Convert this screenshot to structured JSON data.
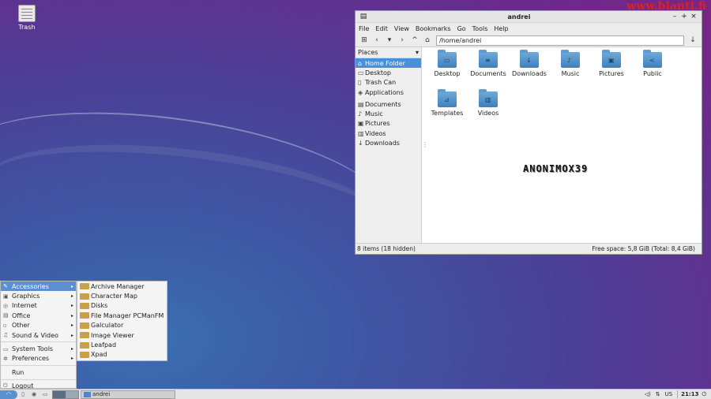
{
  "desktop": {
    "watermark": "www.blanti.fi",
    "icons": [
      {
        "label": "Trash",
        "icon": "trash-icon"
      }
    ]
  },
  "window": {
    "title": "andrei",
    "menu": [
      "File",
      "Edit",
      "View",
      "Bookmarks",
      "Go",
      "Tools",
      "Help"
    ],
    "address": "/home/andrei",
    "places_label": "Places",
    "sidebar": [
      {
        "label": "Home Folder",
        "icon": "home-icon",
        "selected": true
      },
      {
        "label": "Desktop",
        "icon": "desktop-icon"
      },
      {
        "label": "Trash Can",
        "icon": "trash-icon"
      },
      {
        "label": "Applications",
        "icon": "applications-icon"
      },
      {
        "label": "Documents",
        "icon": "documents-icon"
      },
      {
        "label": "Music",
        "icon": "music-icon"
      },
      {
        "label": "Pictures",
        "icon": "pictures-icon"
      },
      {
        "label": "Videos",
        "icon": "videos-icon"
      },
      {
        "label": "Downloads",
        "icon": "downloads-icon"
      }
    ],
    "folders": [
      {
        "label": "Desktop",
        "glyph": "▭"
      },
      {
        "label": "Documents",
        "glyph": "≡"
      },
      {
        "label": "Downloads",
        "glyph": "↓"
      },
      {
        "label": "Music",
        "glyph": "♪"
      },
      {
        "label": "Pictures",
        "glyph": "▣"
      },
      {
        "label": "Public",
        "glyph": "<"
      },
      {
        "label": "Templates",
        "glyph": "⊿"
      },
      {
        "label": "Videos",
        "glyph": "▥"
      }
    ],
    "status_left": "8 items (18 hidden)",
    "status_right": "Free space: 5,8 GiB (Total: 8,4 GiB)",
    "overlay_text": "ANONIMOX39"
  },
  "start_menu": {
    "items": [
      {
        "label": "Accessories",
        "icon": "accessories-icon",
        "submenu": true,
        "selected": true
      },
      {
        "label": "Graphics",
        "icon": "graphics-icon",
        "submenu": true
      },
      {
        "label": "Internet",
        "icon": "internet-icon",
        "submenu": true
      },
      {
        "label": "Office",
        "icon": "office-icon",
        "submenu": true
      },
      {
        "label": "Other",
        "icon": "other-icon",
        "submenu": true
      },
      {
        "label": "Sound & Video",
        "icon": "sound-video-icon",
        "submenu": true
      },
      {
        "label": "System Tools",
        "icon": "system-tools-icon",
        "submenu": true
      },
      {
        "label": "Preferences",
        "icon": "preferences-icon",
        "submenu": true
      },
      {
        "label": "Run",
        "icon": "",
        "submenu": false
      },
      {
        "label": "Logout",
        "icon": "logout-icon",
        "submenu": false
      }
    ],
    "submenu": [
      "Archive Manager",
      "Character Map",
      "Disks",
      "File Manager PCManFM",
      "Galculator",
      "Image Viewer",
      "Leafpad",
      "Xpad"
    ]
  },
  "taskbar": {
    "task_label": "andrei",
    "keyboard_layout": "US",
    "clock": "21:13"
  }
}
